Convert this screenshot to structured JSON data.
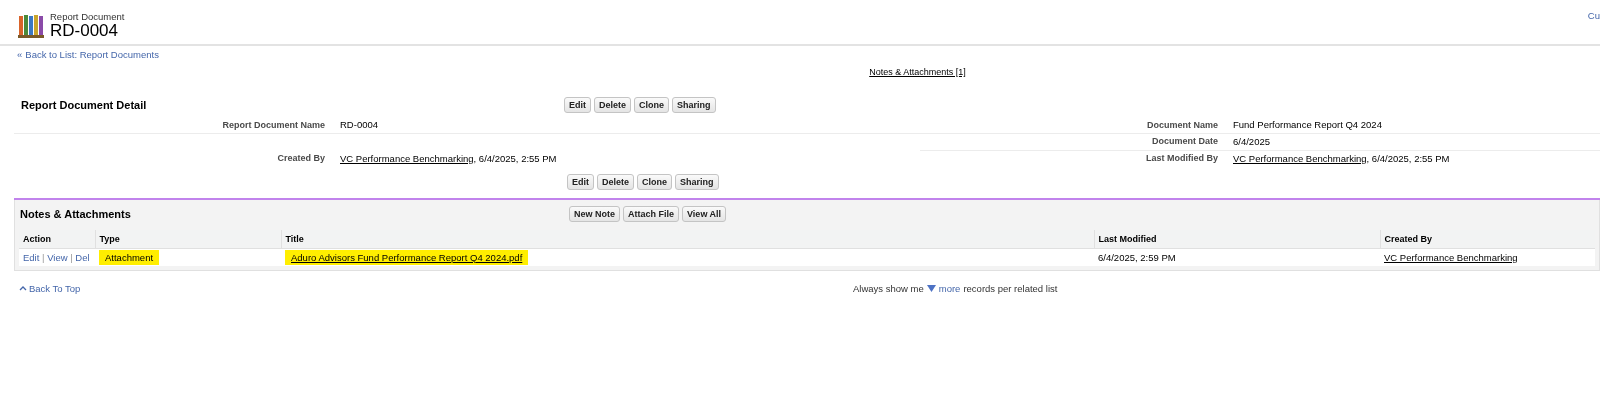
{
  "header": {
    "object_type": "Report Document",
    "record_name": "RD-0004",
    "top_right_link": "Cu"
  },
  "back_link": {
    "marker": "«",
    "label": "Back to List: Report Documents"
  },
  "related_link": "Notes & Attachments [1]",
  "detail": {
    "title": "Report Document Detail",
    "buttons": [
      "Edit",
      "Delete",
      "Clone",
      "Sharing"
    ],
    "rows": [
      {
        "left_label": "Report Document Name",
        "left_value": {
          "text": "RD-0004"
        },
        "right_label": "Document Name",
        "right_value": {
          "text": "Fund Performance Report Q4 2024"
        }
      },
      {
        "right_label": "Document Date",
        "right_value": {
          "text": "6/4/2025"
        }
      },
      {
        "left_label": "Created By",
        "left_value": {
          "link": "VC Performance Benchmarking",
          "text": ", 6/4/2025, 2:55 PM"
        },
        "right_label": "Last Modified By",
        "right_value": {
          "link": "VC Performance Benchmarking",
          "text": ", 6/4/2025, 2:55 PM"
        }
      }
    ],
    "bottom_buttons": [
      "Edit",
      "Delete",
      "Clone",
      "Sharing"
    ]
  },
  "notes": {
    "title": "Notes & Attachments",
    "buttons": [
      "New Note",
      "Attach File",
      "View All"
    ],
    "columns": [
      "Action",
      "Type",
      "Title",
      "Last Modified",
      "Created By"
    ],
    "rows": [
      {
        "actions": [
          "Edit",
          "View",
          "Del"
        ],
        "action_separator": "|",
        "type": {
          "text": "Attachment",
          "highlighted": true
        },
        "title": {
          "text": "Aduro Advisors Fund Performance Report Q4 2024.pdf",
          "highlighted": true
        },
        "last_modified": "6/4/2025, 2:59 PM",
        "created_by": "VC Performance Benchmarking"
      }
    ]
  },
  "footer": {
    "back_to_top": "Back To Top",
    "show_prefix": "Always show me",
    "more": "more",
    "show_suffix": "records per related list"
  }
}
